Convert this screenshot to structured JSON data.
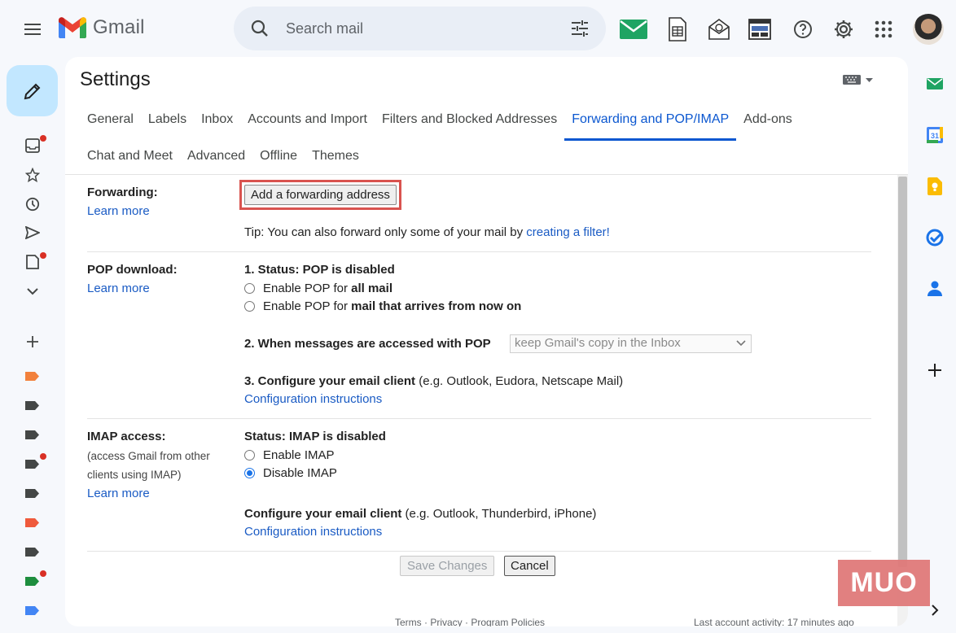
{
  "app": {
    "name": "Gmail",
    "brand_colors": {
      "red": "#ea4335",
      "blue": "#4285f4",
      "green": "#34a853",
      "yellow": "#fbbc04"
    }
  },
  "search": {
    "placeholder": "Search mail"
  },
  "header_icons": [
    "mail-icon",
    "sheet-icon",
    "mail-open-icon",
    "layout-icon",
    "help-icon",
    "settings-icon",
    "apps-icon"
  ],
  "rail": {
    "items": [
      "inbox-icon",
      "star-icon",
      "clock-icon",
      "send-icon",
      "draft-icon",
      "more-icon"
    ],
    "label_colors": [
      "#f2813c",
      "#444746",
      "#444746",
      "#444746",
      "#444746",
      "#ef5a3c",
      "#444746",
      "#1e8e3e",
      "#4285f4"
    ]
  },
  "settings": {
    "title": "Settings",
    "tabs_row1": [
      "General",
      "Labels",
      "Inbox",
      "Accounts and Import",
      "Filters and Blocked Addresses",
      "Forwarding and POP/IMAP",
      "Add-ons"
    ],
    "tabs_row2": [
      "Chat and Meet",
      "Advanced",
      "Offline",
      "Themes"
    ],
    "active_tab": "Forwarding and POP/IMAP"
  },
  "forwarding": {
    "label": "Forwarding:",
    "learn_more": "Learn more",
    "button": "Add a forwarding address",
    "tip_prefix": "Tip: You can also forward only some of your mail by ",
    "tip_link": "creating a filter!"
  },
  "pop": {
    "label": "POP download:",
    "learn_more": "Learn more",
    "status": "1. Status: POP is disabled",
    "opt1_prefix": "Enable POP for ",
    "opt1_bold": "all mail",
    "opt2_prefix": "Enable POP for ",
    "opt2_bold": "mail that arrives from now on",
    "step2": "2. When messages are accessed with POP",
    "step2_select": "keep Gmail's copy in the Inbox",
    "step3_bold": "3. Configure your email client",
    "step3_rest": " (e.g. Outlook, Eudora, Netscape Mail)",
    "config_link": "Configuration instructions"
  },
  "imap": {
    "label": "IMAP access:",
    "note_line1": "(access Gmail from other",
    "note_line2": "clients using IMAP)",
    "learn_more": "Learn more",
    "status": "Status: IMAP is disabled",
    "enable": "Enable IMAP",
    "disable": "Disable IMAP",
    "selected": "Disable IMAP",
    "configure_bold": "Configure your email client",
    "configure_rest": " (e.g. Outlook, Thunderbird, iPhone)",
    "config_link": "Configuration instructions"
  },
  "actions": {
    "save": "Save Changes",
    "cancel": "Cancel"
  },
  "footer": {
    "links": "Terms · Privacy · Program Policies",
    "activity": "Last account activity: 17 minutes ago"
  },
  "side_panel": [
    "mail-icon",
    "calendar-icon",
    "keep-icon",
    "tasks-icon",
    "contacts-icon",
    "add-icon"
  ],
  "watermark": "MUO"
}
